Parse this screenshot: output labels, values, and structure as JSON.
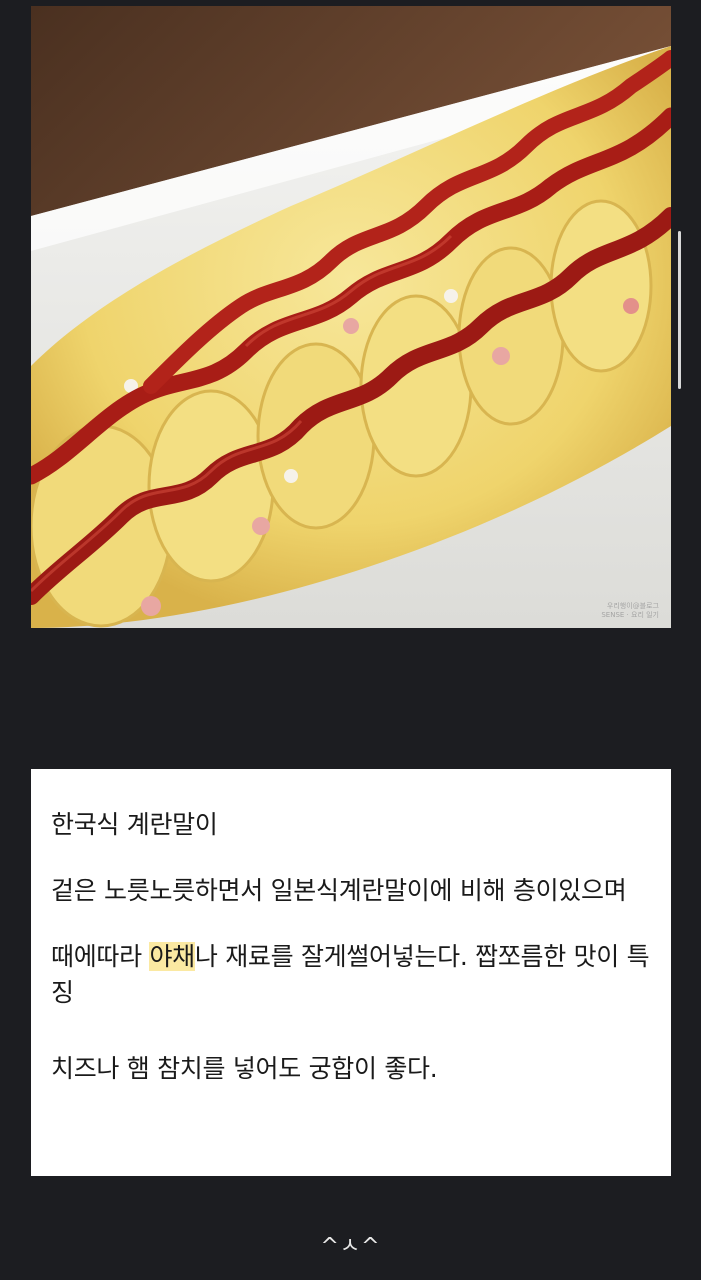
{
  "photo": {
    "alt": "Korean rolled omelette with ketchup",
    "watermark_line1": "우리행이@블로그",
    "watermark_line2": "SENSE · 요리 일기"
  },
  "card": {
    "title": "한국식 계란말이",
    "para1": "겉은 노릇노릇하면서 일본식계란말이에 비해 층이있으며",
    "para2_before": "때에따라 ",
    "para2_highlight": "야채",
    "para2_after": "나 재료를 잘게썰어넣는다. 짭쪼름한 맛이 특징",
    "para3": "치즈나 햄 참치를 넣어도 궁합이 좋다."
  },
  "footer": {
    "emoticon": "^ㅅ^"
  },
  "colors": {
    "background": "#1c1d21",
    "card": "#ffffff",
    "highlight": "#fbe9a2"
  }
}
